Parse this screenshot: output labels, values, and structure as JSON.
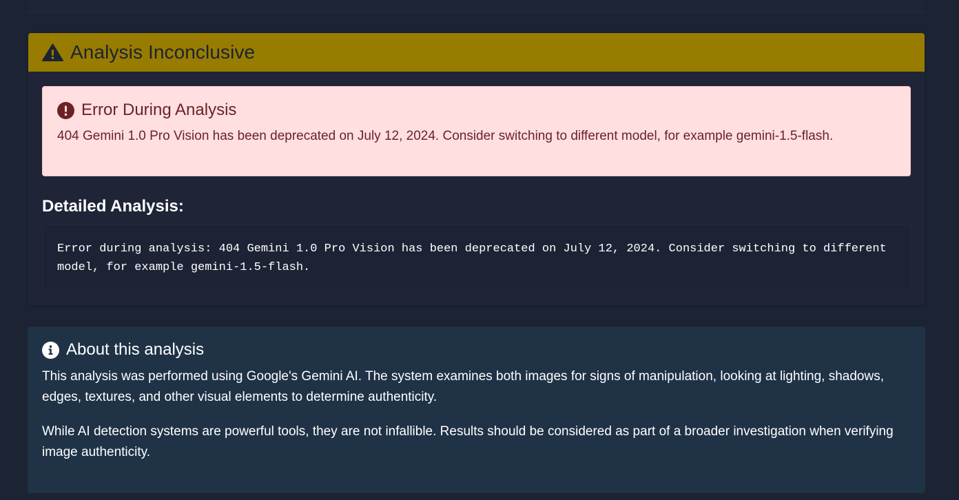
{
  "result": {
    "title": "Analysis Inconclusive",
    "status_color": "#977c00",
    "icon": "warning-triangle-icon"
  },
  "error": {
    "title": "Error During Analysis",
    "message": "404 Gemini 1.0 Pro Vision has been deprecated on July 12, 2024. Consider switching to different model, for example gemini-1.5-flash.",
    "icon": "exclamation-circle-icon",
    "color": "#ffdfe0"
  },
  "detail": {
    "heading": "Detailed Analysis:",
    "text": "Error during analysis: 404 Gemini 1.0 Pro Vision has been deprecated on July 12, 2024. Consider switching to different model, for example gemini-1.5-flash."
  },
  "about": {
    "title": "About this analysis",
    "icon": "info-circle-icon",
    "paragraphs": [
      "This analysis was performed using Google's Gemini AI. The system examines both images for signs of manipulation, looking at lighting, shadows, edges, textures, and other visual elements to determine authenticity.",
      "While AI detection systems are powerful tools, they are not infallible. Results should be considered as part of a broader investigation when verifying image authenticity."
    ]
  }
}
